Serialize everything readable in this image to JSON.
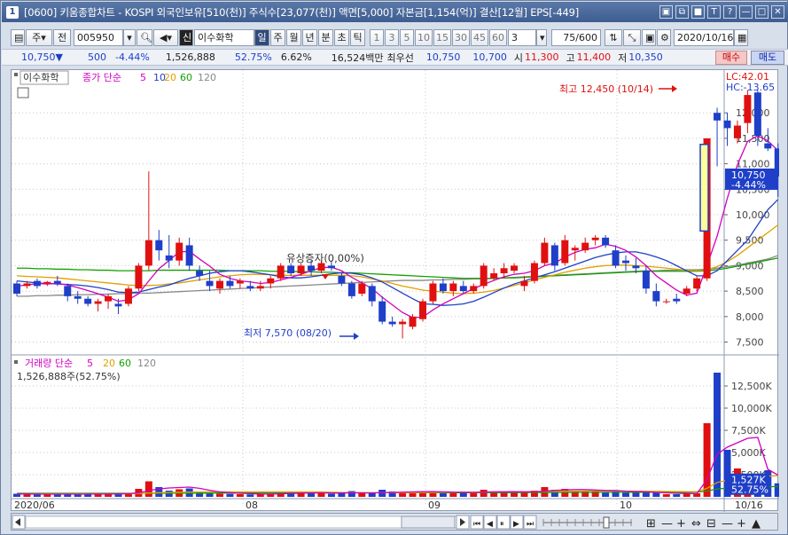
{
  "window": {
    "app_number": "1",
    "title": "[0600] 키움종합차트 - KOSPI 외국인보유[510(천)] 주식수[23,077(천)] 액면[5,000] 자본금[1,154(억)] 결산[12월] EPS[-449]"
  },
  "title_buttons": [
    "▣",
    "⧉",
    "■",
    "T",
    "?",
    "—",
    "□",
    "✕"
  ],
  "toolbar": {
    "type_label": "주",
    "prev_label": "전",
    "stock_code": "005950",
    "stock_badge": "신",
    "stock_name": "이수화학",
    "period_tabs": [
      "일",
      "주",
      "월",
      "년",
      "분",
      "초",
      "틱"
    ],
    "active_period": "일",
    "intervals": [
      "1",
      "3",
      "5",
      "10",
      "15",
      "30",
      "45",
      "60"
    ],
    "interval_value": "3",
    "count_value": "75/600",
    "date_value": "2020/10/16"
  },
  "quote": {
    "price": "10,750",
    "arrow": "▼",
    "change": "500",
    "change_pct": "-4.44%",
    "volume": "1,526,888",
    "vol_ratio": "52.75%",
    "turnover": "6.62%",
    "amount": "16,524백만",
    "best_label": "최우선",
    "ask": "10,750",
    "bid": "10,700",
    "open_label": "시",
    "open": "11,300",
    "high_label": "고",
    "high": "11,400",
    "low_label": "저",
    "low": "10,350",
    "buy_label": "매수",
    "sell_label": "매도"
  },
  "price_legend": {
    "stock_name": "이수화학",
    "ma_label": "종가 단순",
    "periods": [
      "5",
      "10",
      "20",
      "60",
      "120"
    ],
    "colors": [
      "#d000c0",
      "#1f3fc8",
      "#e0a000",
      "#12a000",
      "#888888"
    ]
  },
  "volume_legend": {
    "label": "거래량 단순",
    "periods": [
      "5",
      "20",
      "60",
      "120"
    ],
    "colors": [
      "#d000c0",
      "#e0a000",
      "#12a000",
      "#888888"
    ],
    "value_text": "1,526,888주(52.75%)"
  },
  "annotations": {
    "high_text": "최고 12,450 (10/14)",
    "low_text": "최저 7,570 (08/20)",
    "event_text": "유상증자(0,00%)",
    "lc_text": "LC:42.01",
    "hc_text": "HC:-13.65",
    "current_price": "10,750",
    "current_pct": "-4.44%",
    "vol_current": "1,527K",
    "vol_pct": "52.75%"
  },
  "chart_data": {
    "type": "candlestick",
    "y_ticks": [
      "12,000",
      "11,500",
      "11,000",
      "10,500",
      "10,000",
      "9,500",
      "9,000",
      "8,500",
      "8,000",
      "7,500"
    ],
    "ylim": [
      7300,
      12700
    ],
    "vol_ticks": [
      "12,500K",
      "10,000K",
      "7,500K",
      "5,000K",
      "2,500K"
    ],
    "vol_ylim": [
      0,
      14500
    ],
    "x_labels": [
      "2020/06",
      "08",
      "09",
      "10",
      "10/16"
    ],
    "candles": [
      [
        8650,
        8700,
        8400,
        8450
      ],
      [
        8600,
        8700,
        8550,
        8650
      ],
      [
        8700,
        8750,
        8550,
        8600
      ],
      [
        8650,
        8700,
        8600,
        8680
      ],
      [
        8700,
        8800,
        8600,
        8650
      ],
      [
        8600,
        8650,
        8300,
        8400
      ],
      [
        8400,
        8500,
        8250,
        8350
      ],
      [
        8350,
        8400,
        8200,
        8250
      ],
      [
        8250,
        8350,
        8100,
        8300
      ],
      [
        8300,
        8450,
        8150,
        8400
      ],
      [
        8250,
        8350,
        8050,
        8200
      ],
      [
        8250,
        8600,
        8200,
        8550
      ],
      [
        8550,
        9050,
        8500,
        9000
      ],
      [
        9000,
        10850,
        8900,
        9500
      ],
      [
        9500,
        9700,
        9100,
        9300
      ],
      [
        9200,
        9600,
        8950,
        9100
      ],
      [
        9100,
        9550,
        9000,
        9450
      ],
      [
        9400,
        9550,
        8900,
        9000
      ],
      [
        8900,
        9000,
        8700,
        8800
      ],
      [
        8700,
        8900,
        8500,
        8600
      ],
      [
        8550,
        8750,
        8450,
        8700
      ],
      [
        8700,
        8800,
        8550,
        8600
      ],
      [
        8650,
        8750,
        8550,
        8700
      ],
      [
        8600,
        8700,
        8500,
        8550
      ],
      [
        8550,
        8700,
        8500,
        8600
      ],
      [
        8650,
        8800,
        8550,
        8750
      ],
      [
        8750,
        9050,
        8700,
        9000
      ],
      [
        9000,
        9050,
        8800,
        8850
      ],
      [
        8850,
        9050,
        8800,
        9000
      ],
      [
        9000,
        9100,
        8800,
        8900
      ],
      [
        8900,
        9100,
        8850,
        9050
      ],
      [
        9000,
        9100,
        8900,
        8950
      ],
      [
        8800,
        8850,
        8600,
        8650
      ],
      [
        8650,
        8700,
        8350,
        8400
      ],
      [
        8450,
        8700,
        8400,
        8650
      ],
      [
        8600,
        8650,
        8200,
        8300
      ],
      [
        8300,
        8400,
        7850,
        7900
      ],
      [
        7900,
        8000,
        7800,
        7850
      ],
      [
        7850,
        7950,
        7570,
        7900
      ],
      [
        7800,
        8050,
        7750,
        8000
      ],
      [
        7950,
        8350,
        7900,
        8300
      ],
      [
        8300,
        8700,
        8250,
        8650
      ],
      [
        8650,
        8750,
        8450,
        8500
      ],
      [
        8500,
        8700,
        8400,
        8650
      ],
      [
        8600,
        8700,
        8450,
        8500
      ],
      [
        8500,
        8650,
        8450,
        8600
      ],
      [
        8600,
        9050,
        8550,
        9000
      ],
      [
        8750,
        8950,
        8700,
        8850
      ],
      [
        8850,
        9050,
        8750,
        8950
      ],
      [
        8900,
        9050,
        8850,
        9000
      ],
      [
        8600,
        8800,
        8500,
        8700
      ],
      [
        8700,
        9100,
        8650,
        9050
      ],
      [
        9050,
        9550,
        9000,
        9450
      ],
      [
        9400,
        9450,
        8900,
        9000
      ],
      [
        9050,
        9600,
        9000,
        9500
      ],
      [
        9300,
        9400,
        9100,
        9350
      ],
      [
        9300,
        9550,
        9250,
        9450
      ],
      [
        9500,
        9600,
        9400,
        9550
      ],
      [
        9550,
        9600,
        9350,
        9400
      ],
      [
        9300,
        9400,
        8950,
        9000
      ],
      [
        9100,
        9200,
        8900,
        9050
      ],
      [
        9000,
        9150,
        8850,
        8950
      ],
      [
        8900,
        9000,
        8450,
        8550
      ],
      [
        8500,
        8650,
        8200,
        8300
      ],
      [
        8300,
        8350,
        8250,
        8300
      ],
      [
        8350,
        8450,
        8250,
        8300
      ],
      [
        8450,
        8600,
        8400,
        8550
      ],
      [
        8550,
        8800,
        8500,
        8750
      ],
      [
        8750,
        11500,
        8700,
        11500
      ],
      [
        12000,
        12100,
        10950,
        11850
      ],
      [
        11850,
        12000,
        11350,
        11700
      ],
      [
        11500,
        11850,
        11400,
        11750
      ],
      [
        11800,
        12450,
        11600,
        12350
      ],
      [
        12400,
        12450,
        11350,
        11550
      ],
      [
        11400,
        11700,
        11250,
        11300
      ],
      [
        11300,
        11400,
        10350,
        10750
      ]
    ],
    "volume": [
      350,
      300,
      320,
      280,
      250,
      380,
      300,
      350,
      300,
      330,
      320,
      450,
      900,
      1750,
      1100,
      700,
      850,
      950,
      500,
      400,
      350,
      330,
      300,
      280,
      350,
      300,
      550,
      500,
      450,
      400,
      400,
      350,
      450,
      650,
      400,
      400,
      800,
      600,
      550,
      450,
      500,
      650,
      500,
      450,
      400,
      400,
      800,
      600,
      550,
      500,
      450,
      700,
      1100,
      800,
      900,
      600,
      650,
      700,
      550,
      600,
      500,
      450,
      550,
      450,
      300,
      300,
      350,
      400,
      8300,
      14000,
      5300,
      3200,
      2300,
      2100,
      3000,
      1527
    ],
    "ma5": [
      8600,
      8620,
      8650,
      8640,
      8650,
      8620,
      8570,
      8510,
      8450,
      8380,
      8300,
      8330,
      8450,
      8700,
      8940,
      9100,
      9270,
      9280,
      9130,
      8990,
      8830,
      8750,
      8700,
      8680,
      8650,
      8670,
      8720,
      8770,
      8830,
      8900,
      8960,
      8970,
      8900,
      8770,
      8660,
      8550,
      8380,
      8230,
      8080,
      7980,
      7990,
      8130,
      8250,
      8350,
      8450,
      8550,
      8630,
      8710,
      8780,
      8830,
      8850,
      8900,
      9000,
      9050,
      9170,
      9260,
      9320,
      9350,
      9420,
      9380,
      9300,
      9170,
      9000,
      8800,
      8660,
      8520,
      8420,
      8460,
      9000,
      9580,
      10320,
      10980,
      11440,
      11550,
      11450,
      11260
    ],
    "ma10": [
      8700,
      8680,
      8660,
      8650,
      8640,
      8630,
      8620,
      8600,
      8570,
      8530,
      8480,
      8470,
      8480,
      8530,
      8580,
      8620,
      8690,
      8750,
      8800,
      8850,
      8880,
      8900,
      8900,
      8880,
      8850,
      8820,
      8780,
      8760,
      8760,
      8780,
      8810,
      8840,
      8860,
      8850,
      8820,
      8760,
      8680,
      8570,
      8460,
      8350,
      8250,
      8240,
      8220,
      8230,
      8250,
      8300,
      8380,
      8470,
      8560,
      8640,
      8700,
      8760,
      8820,
      8880,
      8950,
      9020,
      9090,
      9160,
      9210,
      9250,
      9270,
      9270,
      9230,
      9170,
      9100,
      9000,
      8900,
      8800,
      8800,
      8900,
      9100,
      9300,
      9500,
      9800,
      10100,
      10300
    ],
    "ma20": [
      8800,
      8790,
      8780,
      8770,
      8760,
      8740,
      8720,
      8700,
      8680,
      8660,
      8640,
      8620,
      8610,
      8610,
      8620,
      8640,
      8660,
      8690,
      8720,
      8750,
      8780,
      8800,
      8820,
      8830,
      8830,
      8820,
      8810,
      8810,
      8810,
      8810,
      8810,
      8810,
      8810,
      8800,
      8780,
      8740,
      8700,
      8650,
      8600,
      8560,
      8520,
      8500,
      8480,
      8460,
      8450,
      8460,
      8480,
      8510,
      8560,
      8610,
      8660,
      8720,
      8770,
      8820,
      8870,
      8910,
      8950,
      8980,
      9000,
      9010,
      9010,
      9000,
      8990,
      8970,
      8950,
      8930,
      8910,
      8900,
      8920,
      8980,
      9080,
      9200,
      9350,
      9500,
      9650,
      9800
    ],
    "ma60": [
      8950,
      8950,
      8940,
      8940,
      8930,
      8930,
      8920,
      8920,
      8910,
      8910,
      8900,
      8900,
      8900,
      8900,
      8910,
      8910,
      8910,
      8910,
      8910,
      8910,
      8910,
      8900,
      8900,
      8900,
      8900,
      8890,
      8890,
      8890,
      8880,
      8880,
      8870,
      8870,
      8860,
      8860,
      8850,
      8840,
      8830,
      8820,
      8810,
      8800,
      8790,
      8780,
      8770,
      8760,
      8750,
      8750,
      8750,
      8750,
      8760,
      8760,
      8770,
      8780,
      8790,
      8800,
      8810,
      8820,
      8830,
      8840,
      8850,
      8860,
      8870,
      8880,
      8890,
      8890,
      8890,
      8890,
      8890,
      8890,
      8900,
      8920,
      8950,
      8990,
      9030,
      9070,
      9110,
      9150
    ],
    "ma120": [
      8400,
      8400,
      8410,
      8410,
      8420,
      8420,
      8430,
      8430,
      8440,
      8440,
      8450,
      8450,
      8460,
      8460,
      8470,
      8480,
      8490,
      8500,
      8510,
      8520,
      8530,
      8540,
      8550,
      8560,
      8570,
      8580,
      8590,
      8600,
      8610,
      8620,
      8630,
      8640,
      8650,
      8660,
      8670,
      8680,
      8690,
      8700,
      8710,
      8710,
      8710,
      8720,
      8720,
      8730,
      8730,
      8740,
      8740,
      8750,
      8760,
      8770,
      8780,
      8790,
      8800,
      8810,
      8820,
      8830,
      8840,
      8850,
      8860,
      8870,
      8880,
      8890,
      8900,
      8900,
      8910,
      8910,
      8920,
      8920,
      8930,
      8950,
      8980,
      9010,
      9050,
      9090,
      9130,
      9200
    ],
    "vol_ma5": [
      330,
      320,
      310,
      300,
      300,
      310,
      300,
      310,
      310,
      320,
      330,
      360,
      450,
      700,
      900,
      1000,
      1050,
      1100,
      960,
      740,
      560,
      470,
      400,
      360,
      320,
      310,
      340,
      380,
      420,
      440,
      450,
      440,
      430,
      460,
      450,
      440,
      480,
      500,
      530,
      560,
      580,
      600,
      560,
      540,
      520,
      500,
      530,
      560,
      570,
      580,
      560,
      560,
      640,
      730,
      780,
      820,
      820,
      770,
      720,
      720,
      640,
      600,
      560,
      500,
      450,
      400,
      380,
      360,
      1950,
      4800,
      5600,
      6100,
      6600,
      6700,
      3100,
      2450
    ],
    "vol_ma20": [
      330,
      330,
      330,
      330,
      330,
      330,
      330,
      330,
      330,
      330,
      340,
      350,
      380,
      430,
      470,
      500,
      520,
      540,
      550,
      560,
      560,
      560,
      560,
      560,
      560,
      560,
      560,
      560,
      560,
      560,
      560,
      520,
      500,
      480,
      470,
      460,
      460,
      460,
      470,
      480,
      490,
      500,
      510,
      520,
      530,
      540,
      550,
      560,
      570,
      580,
      590,
      600,
      610,
      620,
      630,
      640,
      650,
      660,
      660,
      660,
      650,
      640,
      630,
      620,
      610,
      600,
      590,
      580,
      960,
      1620,
      1880,
      2020,
      2110,
      2200,
      2330,
      2390
    ],
    "vol_ma60": [
      400,
      400,
      400,
      400,
      400,
      400,
      400,
      400,
      400,
      400,
      400,
      400,
      400,
      400,
      400,
      410,
      410,
      420,
      420,
      420,
      430,
      430,
      430,
      430,
      440,
      440,
      440,
      440,
      440,
      450,
      450,
      450,
      450,
      450,
      450,
      460,
      460,
      460,
      460,
      460,
      470,
      470,
      470,
      470,
      470,
      480,
      480,
      480,
      480,
      480,
      490,
      490,
      490,
      500,
      500,
      500,
      500,
      500,
      510,
      510,
      510,
      510,
      520,
      520,
      520,
      520,
      520,
      530,
      660,
      890,
      980,
      1030,
      1070,
      1100,
      1140,
      1170
    ]
  }
}
